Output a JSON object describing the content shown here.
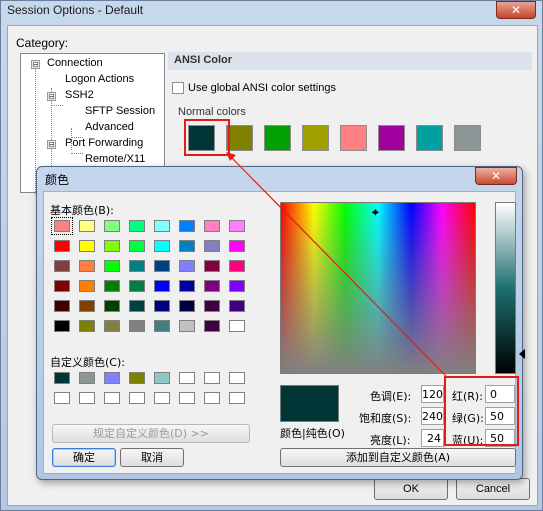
{
  "outer": {
    "title": "Session Options - Default",
    "close_symbol": "✕",
    "category_label": "Category:",
    "tree": [
      {
        "label": "Connection",
        "box": "⊟"
      },
      {
        "label": "Logon Actions"
      },
      {
        "label": "SSH2",
        "box": "⊟"
      },
      {
        "label": "SFTP Session"
      },
      {
        "label": "Advanced"
      },
      {
        "label": "Port Forwarding",
        "box": "⊟"
      },
      {
        "label": "Remote/X11"
      }
    ],
    "panel_title": "ANSI Color",
    "use_global_label": "Use global ANSI color settings",
    "normal_colors_label": "Normal colors",
    "normal_colors": [
      "#003535",
      "#808000",
      "#00a000",
      "#a0a000",
      "#ff8080",
      "#a000a0",
      "#00a0a0",
      "#8c9696"
    ],
    "ok_label": "OK",
    "cancel_label": "Cancel"
  },
  "dialog": {
    "title": "颜色",
    "close_symbol": "✕",
    "basic_colors_label": "基本颜色(B):",
    "basic_colors": [
      "#ff8080",
      "#ffff80",
      "#80ff80",
      "#00ff80",
      "#80ffff",
      "#0080ff",
      "#ff80c0",
      "#ff80ff",
      "#ff0000",
      "#ffff00",
      "#80ff00",
      "#00ff40",
      "#00ffff",
      "#0080c0",
      "#8080c0",
      "#ff00ff",
      "#804040",
      "#ff8040",
      "#00ff00",
      "#008080",
      "#004080",
      "#8080ff",
      "#800040",
      "#ff0080",
      "#800000",
      "#ff8000",
      "#008000",
      "#008040",
      "#0000ff",
      "#0000a0",
      "#800080",
      "#8000ff",
      "#400000",
      "#804000",
      "#004000",
      "#004040",
      "#000080",
      "#000040",
      "#400040",
      "#400080",
      "#000000",
      "#808000",
      "#808040",
      "#808080",
      "#408080",
      "#c0c0c0",
      "#400040",
      "#ffffff"
    ],
    "custom_colors_label": "自定义颜色(C):",
    "custom_colors": [
      "#003535",
      "#8c9696",
      "#8080ff",
      "#808000",
      "#8fc6c6",
      "#ffffff",
      "#ffffff",
      "#ffffff",
      "#ffffff",
      "#ffffff",
      "#ffffff",
      "#ffffff",
      "#ffffff",
      "#ffffff",
      "#ffffff",
      "#ffffff"
    ],
    "define_custom_button": "规定自定义颜色(D) >>",
    "ok_button": "确定",
    "cancel_button": "取消",
    "preview_color": "#003535",
    "color_solid_label": "颜色|纯色(O)",
    "hue_label": "色调(E):",
    "hue": "120",
    "sat_label": "饱和度(S):",
    "sat": "240",
    "lum_label": "亮度(L):",
    "lum": "24",
    "red_label": "红(R):",
    "red": "0",
    "green_label": "绿(G):",
    "green": "50",
    "blue_label": "蓝(U):",
    "blue": "50",
    "add_custom_button": "添加到自定义颜色(A)"
  }
}
